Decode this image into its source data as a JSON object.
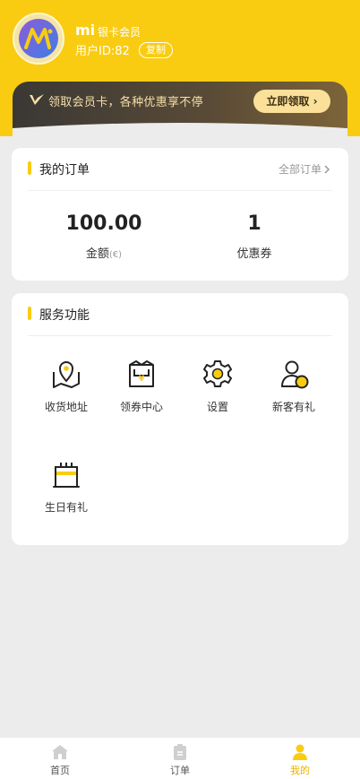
{
  "user": {
    "avatar_icon": "mi-logo-avatar",
    "name": "mi",
    "level": "银卡会员",
    "uid_label": "用户ID:82",
    "copy_label": "复制"
  },
  "vip_banner": {
    "icon": "vip-v-icon",
    "text": "领取会员卡，各种优惠享不停",
    "button_label": "立即领取"
  },
  "orders": {
    "title": "我的订单",
    "all_label": "全部订单",
    "stats": [
      {
        "value": "100.00",
        "label": "金额",
        "unit": "(€)"
      },
      {
        "value": "1",
        "label": "优惠券",
        "unit": ""
      }
    ]
  },
  "services": {
    "title": "服务功能",
    "items": [
      {
        "label": "收货地址",
        "icon": "map-location-icon"
      },
      {
        "label": "领券中心",
        "icon": "coupon-center-icon"
      },
      {
        "label": "设置",
        "icon": "gear-icon"
      },
      {
        "label": "新客有礼",
        "icon": "new-customer-icon"
      },
      {
        "label": "生日有礼",
        "icon": "birthday-cake-icon"
      }
    ]
  },
  "tabbar": {
    "items": [
      {
        "label": "首页",
        "icon": "home-icon",
        "active": false
      },
      {
        "label": "订单",
        "icon": "order-icon",
        "active": false
      },
      {
        "label": "我的",
        "icon": "user-icon",
        "active": true
      }
    ]
  },
  "colors": {
    "brand_yellow": "#f9cc12",
    "active_tab": "#e8b500",
    "vip_gold": "#fbe09a"
  }
}
